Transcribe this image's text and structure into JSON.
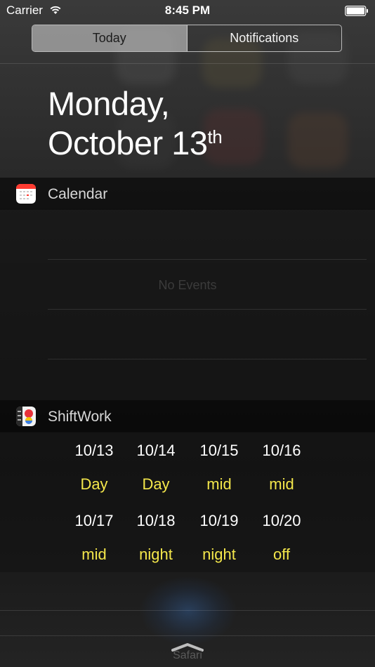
{
  "status_bar": {
    "carrier": "Carrier",
    "time": "8:45 PM"
  },
  "tabs": [
    {
      "label": "Today",
      "selected": true
    },
    {
      "label": "Notifications",
      "selected": false
    }
  ],
  "date": {
    "line1": "Monday,",
    "line2": "October 13",
    "suffix": "th"
  },
  "calendar_widget": {
    "title": "Calendar",
    "icon": "calendar-icon",
    "empty_text": "No Events"
  },
  "shiftwork_widget": {
    "title": "ShiftWork",
    "icon": "shiftwork-app-icon",
    "days": [
      {
        "date": "10/13",
        "shift": "Day"
      },
      {
        "date": "10/14",
        "shift": "Day"
      },
      {
        "date": "10/15",
        "shift": "mid"
      },
      {
        "date": "10/16",
        "shift": "mid"
      },
      {
        "date": "10/17",
        "shift": "mid"
      },
      {
        "date": "10/18",
        "shift": "night"
      },
      {
        "date": "10/19",
        "shift": "night"
      },
      {
        "date": "10/20",
        "shift": "off"
      }
    ]
  },
  "dock": {
    "label": "Safari",
    "icon": "grabber-handle-icon"
  },
  "colors": {
    "shift_value": "#f4e74b",
    "background": "#141414",
    "selected_tab": "#c8c8c8"
  }
}
